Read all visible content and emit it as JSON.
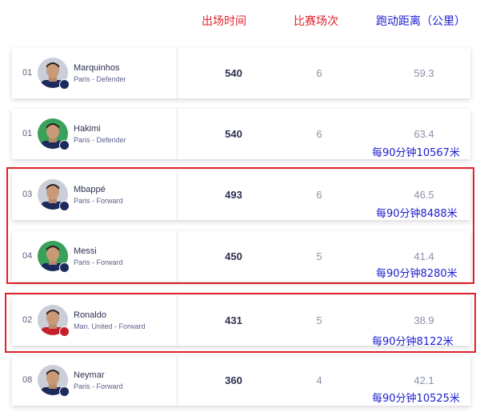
{
  "headers": {
    "minutes": "出场时间",
    "matches": "比赛场次",
    "distance": "跑动距离（公里）"
  },
  "colors": {
    "header_red": "#e0202a",
    "header_blue": "#1c1cd0",
    "note_blue": "#1c1cd0",
    "highlight_box": "#e0202a"
  },
  "players": [
    {
      "rank": "01",
      "name": "Marquinhos",
      "info": "Paris - Defender",
      "minutes": "540",
      "matches": "6",
      "distance": "59.3",
      "note": "",
      "badge": "psg-badge-icon",
      "shirt": "#1c2a5c",
      "bg": "#c9ced8"
    },
    {
      "rank": "01",
      "name": "Hakimi",
      "info": "Paris - Defender",
      "minutes": "540",
      "matches": "6",
      "distance": "63.4",
      "note": "每90分钟10567米",
      "badge": "psg-badge-icon",
      "shirt": "#1c2a5c",
      "bg": "#3aa05a"
    },
    {
      "rank": "03",
      "name": "Mbappé",
      "info": "Paris - Forward",
      "minutes": "493",
      "matches": "6",
      "distance": "46.5",
      "note": "每90分钟8488米",
      "badge": "psg-badge-icon",
      "shirt": "#1c2a5c",
      "bg": "#c9ced8"
    },
    {
      "rank": "04",
      "name": "Messi",
      "info": "Paris - Forward",
      "minutes": "450",
      "matches": "5",
      "distance": "41.4",
      "note": "每90分钟8280米",
      "badge": "psg-badge-icon",
      "shirt": "#1c2a5c",
      "bg": "#3aa05a"
    },
    {
      "rank": "02",
      "name": "Ronaldo",
      "info": "Man. United - Forward",
      "minutes": "431",
      "matches": "5",
      "distance": "38.9",
      "note": "每90分钟8122米",
      "badge": "man-united-badge-icon",
      "shirt": "#c8202a",
      "bg": "#c9ced8"
    },
    {
      "rank": "08",
      "name": "Neymar",
      "info": "Paris - Forward",
      "minutes": "360",
      "matches": "4",
      "distance": "42.1",
      "note": "每90分钟10525米",
      "badge": "psg-badge-icon",
      "shirt": "#1c2a5c",
      "bg": "#c9ced8"
    }
  ]
}
